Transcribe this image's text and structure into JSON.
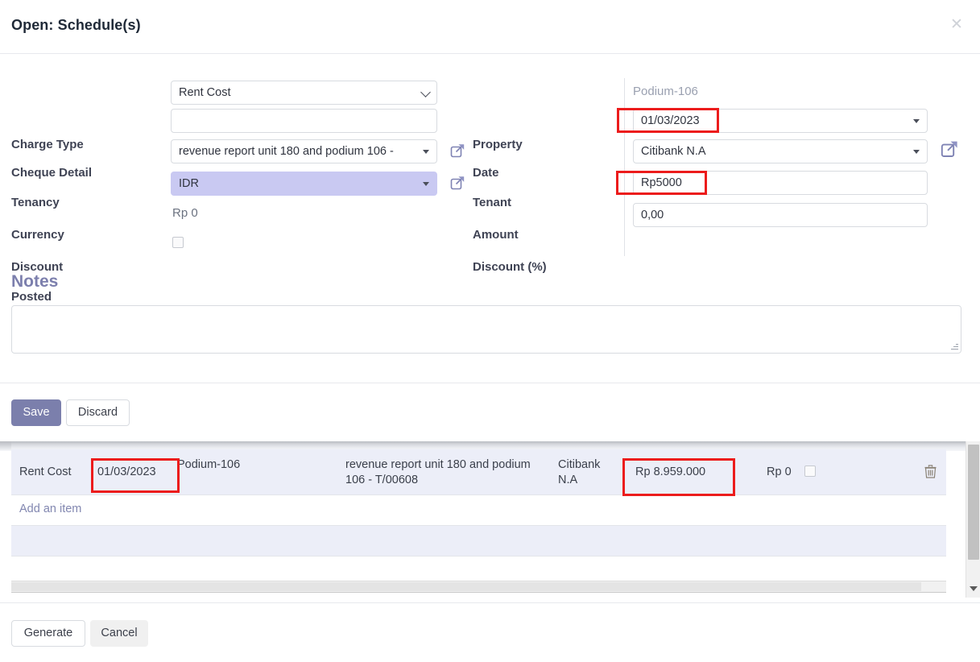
{
  "dialog": {
    "title": "Open: Schedule(s)",
    "close_icon": "close-icon"
  },
  "form": {
    "left_column": [
      {
        "label": "Charge Type",
        "value": "Rent Cost",
        "control": "select"
      },
      {
        "label": "Cheque Detail",
        "value": "",
        "control": "text"
      },
      {
        "label": "Tenancy",
        "value": "revenue report unit 180 and podium 106 -",
        "control": "select"
      },
      {
        "label": "Currency",
        "value": "IDR",
        "control": "select"
      },
      {
        "label": "Discount",
        "value": "Rp 0",
        "control": "static"
      },
      {
        "label": "Posted",
        "value": "",
        "control": "checkbox"
      }
    ],
    "right_column": [
      {
        "label": "Property",
        "value": "Podium-106",
        "control": "static"
      },
      {
        "label": "Date",
        "value": "01/03/2023",
        "control": "select"
      },
      {
        "label": "Tenant",
        "value": "Citibank N.A",
        "control": "select",
        "icon": "external-link-icon"
      },
      {
        "label": "Amount",
        "value": "Rp5000",
        "control": "text",
        "icon": "external-link-icon"
      },
      {
        "label": "Discount (%)",
        "value": "0,00",
        "control": "text"
      }
    ],
    "tenant_open_icon": "external-link-icon"
  },
  "notes": {
    "heading": "Notes",
    "value": "",
    "placeholder": ""
  },
  "actions": {
    "save_label": "Save",
    "discard_label": "Discard"
  },
  "list": {
    "rows": [
      {
        "charge_type": "Rent Cost",
        "date": "01/03/2023",
        "property": "Podium-106",
        "tenancy": "revenue report unit 180 and podium 106 - T/00608",
        "tenant": "Citibank N.A",
        "amount": "Rp 8.959.000",
        "discount": "Rp 0",
        "posted": false,
        "delete_icon": "trash-icon"
      }
    ],
    "add_item_label": "Add an item"
  },
  "footer": {
    "generate_label": "Generate",
    "cancel_label": "Cancel"
  },
  "colors": {
    "accent": "#7b7fac",
    "notes_heading": "#7c7fad",
    "row_highlight": "#eceef8",
    "field_selected": "#c9c9f2",
    "annotation": "#ec1c1c",
    "muted_text": "#9aa0b0"
  }
}
